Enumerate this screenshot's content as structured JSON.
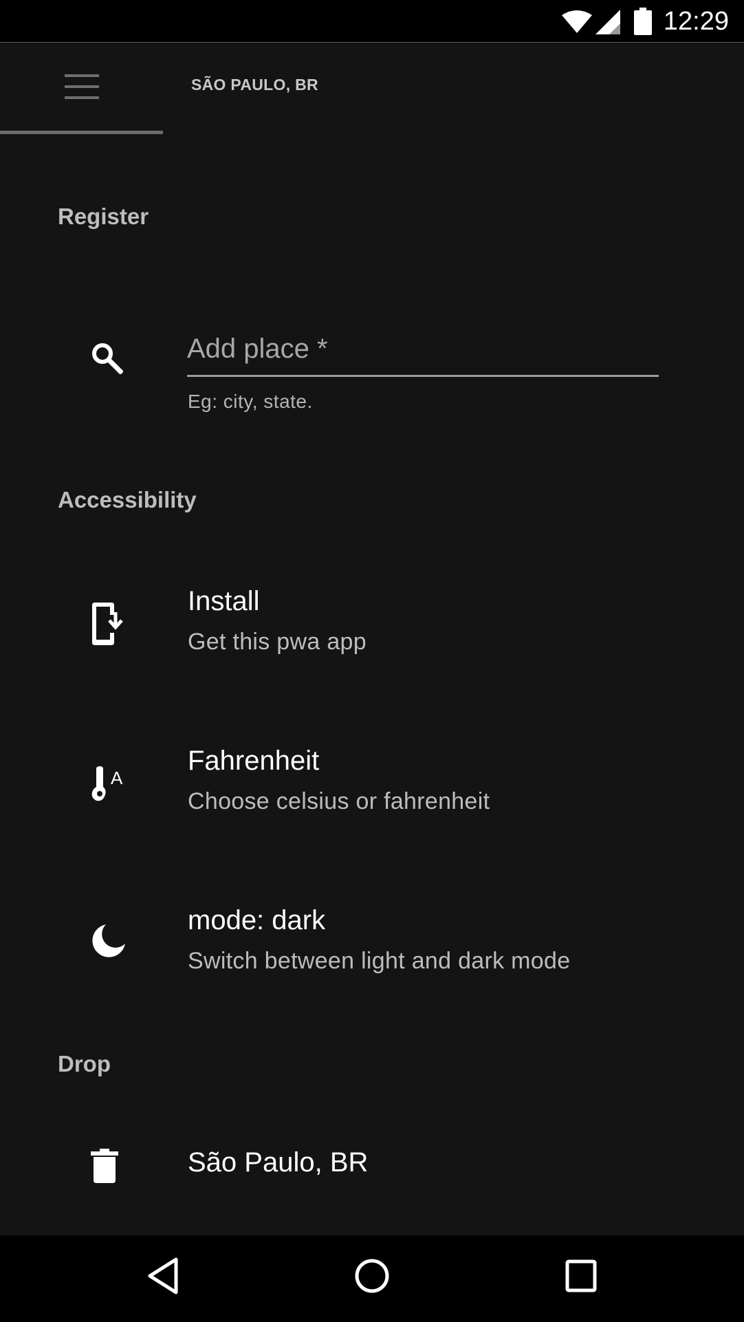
{
  "status_bar": {
    "time": "12:29",
    "icons": [
      "wifi-icon",
      "signal-icon",
      "battery-icon"
    ]
  },
  "app_bar": {
    "location": "SÃO PAULO, BR",
    "menu_icon": "menu-icon"
  },
  "sections": {
    "register": "Register",
    "accessibility": "Accessibility",
    "drop": "Drop"
  },
  "search": {
    "placeholder": "Add place *",
    "helper": "Eg: city, state."
  },
  "items": {
    "install": {
      "title": "Install",
      "subtitle": "Get this pwa app",
      "icon": "install-mobile-icon"
    },
    "fahrenheit": {
      "title": "Fahrenheit",
      "subtitle": "Choose celsius or fahrenheit",
      "icon": "thermometer-icon"
    },
    "mode": {
      "title": "mode: dark",
      "subtitle": "Switch between light and dark mode",
      "icon": "moon-icon"
    },
    "drop_place": {
      "title": "São Paulo, BR",
      "icon": "trash-icon"
    }
  },
  "colors": {
    "background": "#141414",
    "text": "#ffffff",
    "secondary_text": "#bdbdbd"
  }
}
